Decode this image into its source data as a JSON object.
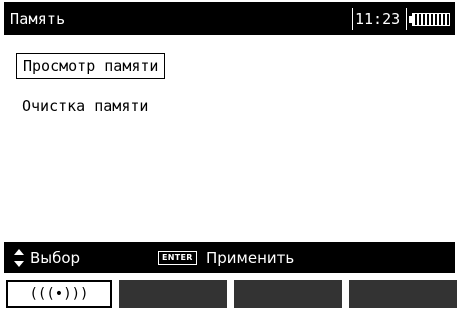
{
  "header": {
    "title": "Память",
    "time": "11:23",
    "battery_icon": "battery-icon"
  },
  "menu": {
    "items": [
      {
        "label": "Просмотр памяти",
        "selected": true
      },
      {
        "label": "Очистка памяти",
        "selected": false
      }
    ]
  },
  "hints": {
    "select_icon": "updown-arrows-icon",
    "select_label": "Выбор",
    "enter_key": "ENTER",
    "apply_label": "Применить"
  },
  "softkeys": {
    "k1_label": "(((•)))",
    "k1_icon": "wireless-icon"
  },
  "colors": {
    "bar_bg": "#000000",
    "bar_fg": "#ffffff",
    "softkey_inactive": "#333333"
  }
}
